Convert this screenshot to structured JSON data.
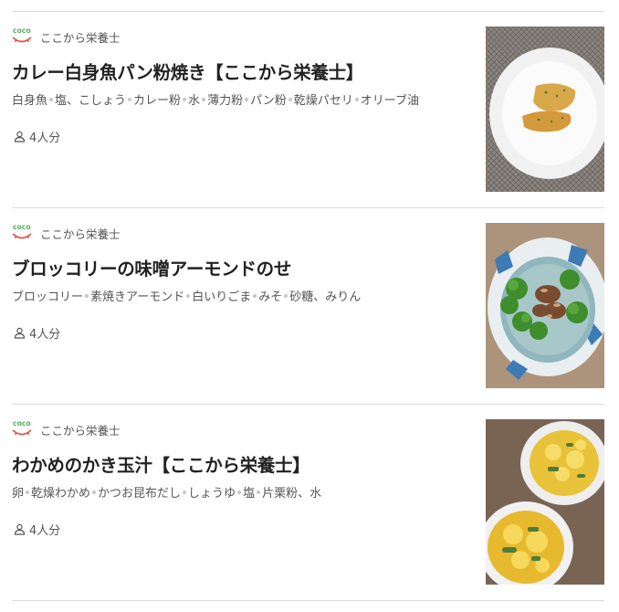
{
  "recipes": [
    {
      "author": "ここから栄養士",
      "title": "カレー白身魚パン粉焼き【ここから栄養士】",
      "ingredients": [
        "白身魚",
        "塩、こしょう",
        "カレー粉",
        "水",
        "薄力粉",
        "パン粉",
        "乾燥パセリ",
        "オリーブ油"
      ],
      "servings": "4人分",
      "image": "curry-white-fish-photo"
    },
    {
      "author": "ここから栄養士",
      "title": "ブロッコリーの味噌アーモンドのせ",
      "ingredients": [
        "ブロッコリー",
        "素焼きアーモンド",
        "白いりごま",
        "みそ",
        "砂糖、みりん"
      ],
      "servings": "4人分",
      "image": "broccoli-almond-photo"
    },
    {
      "author": "ここから栄養士",
      "title": "わかめのかき玉汁【ここから栄養士】",
      "ingredients": [
        "卵",
        "乾燥わかめ",
        "かつお昆布だし",
        "しょうゆ",
        "塩",
        "片栗粉、水"
      ],
      "servings": "4人分",
      "image": "wakame-egg-soup-photo"
    }
  ],
  "logo_text": "COCO",
  "colors": {
    "logo_green": "#44a64a",
    "logo_red": "#e0524f",
    "divider": "#dcdcdc"
  }
}
